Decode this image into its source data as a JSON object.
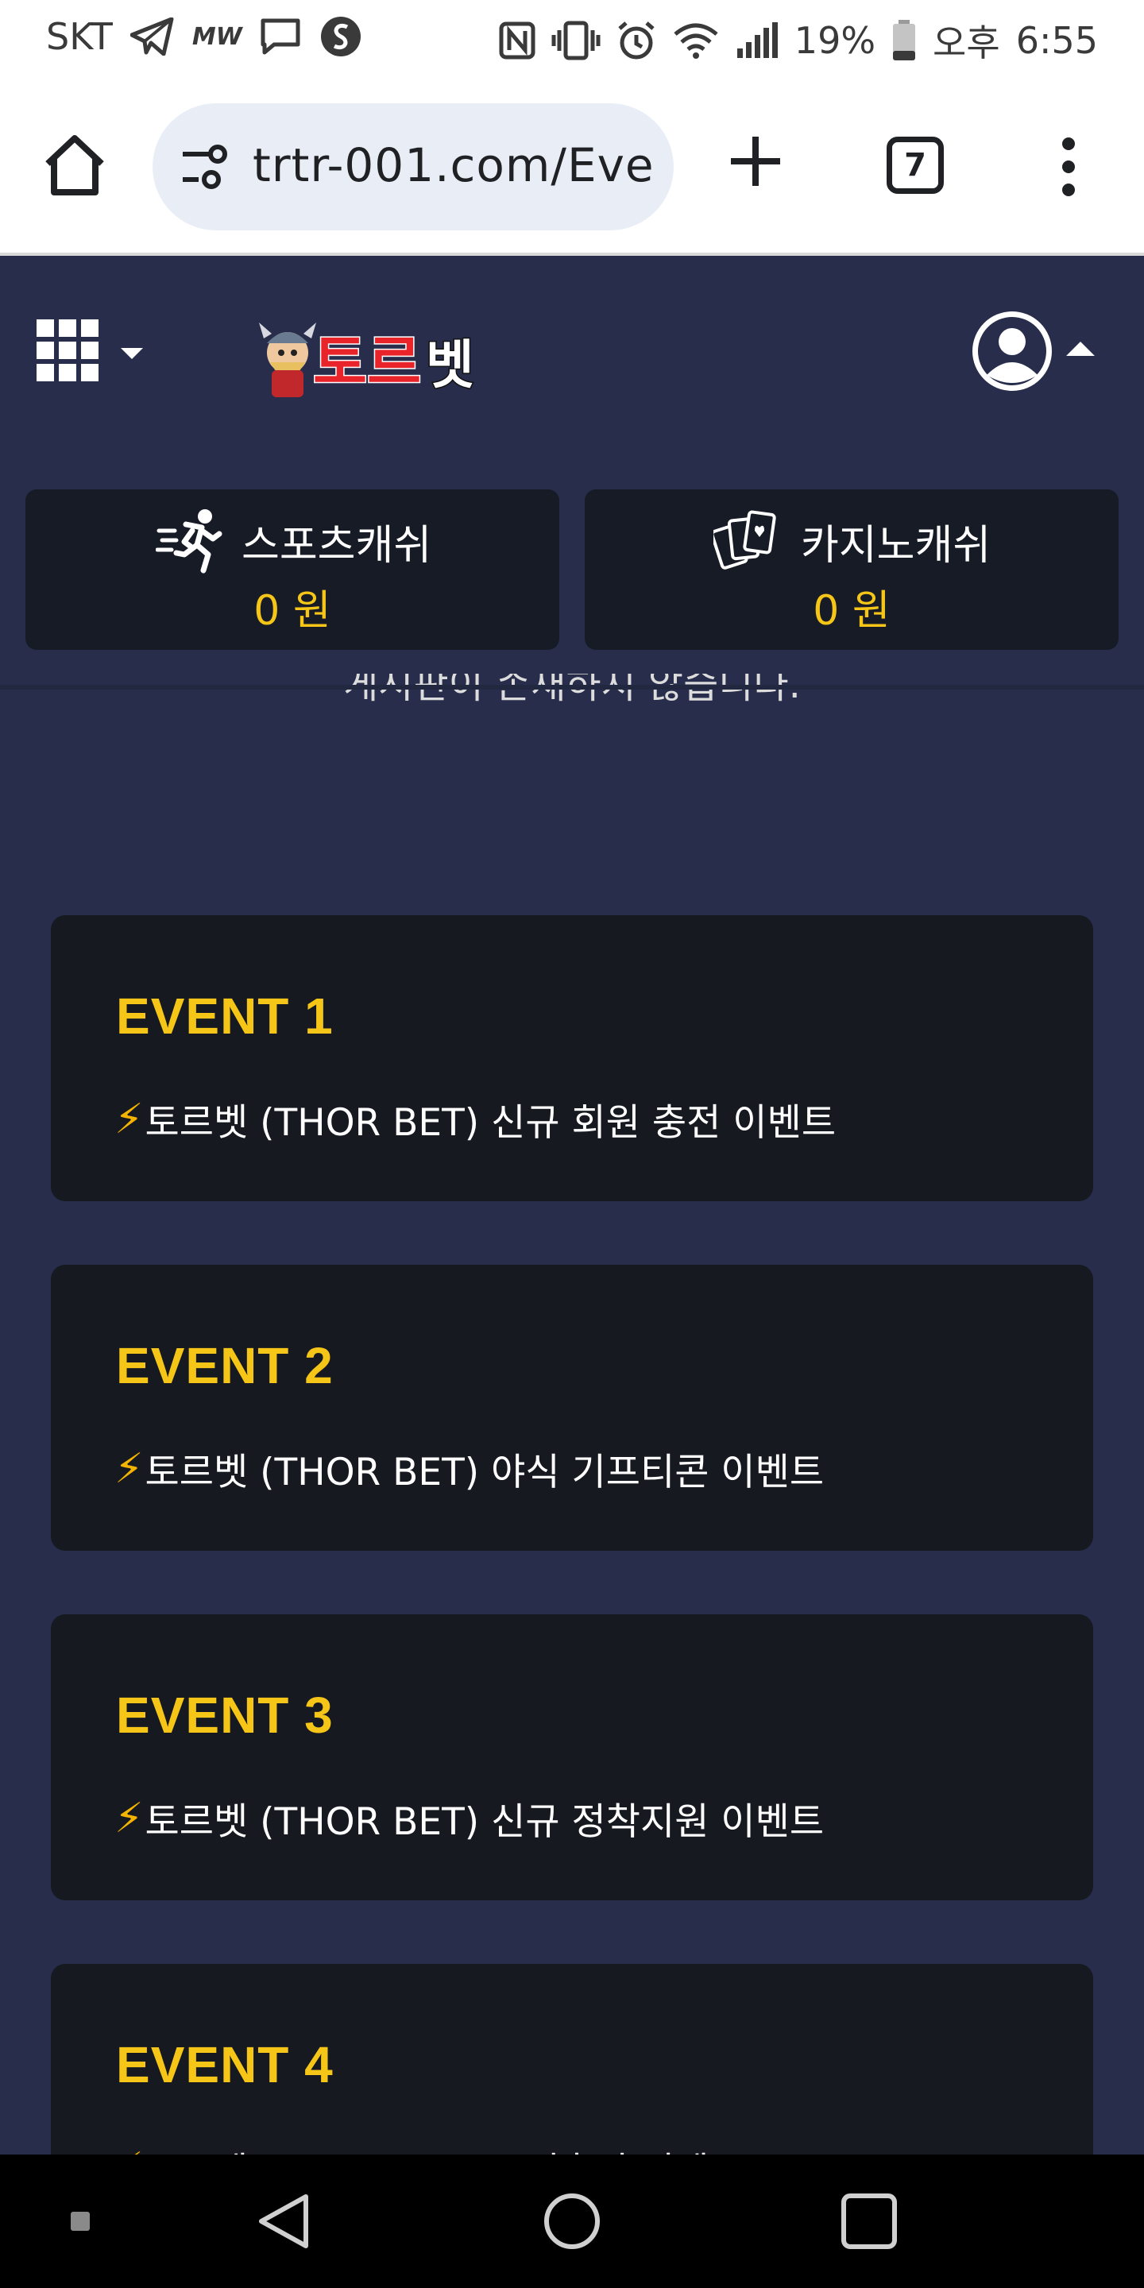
{
  "status_bar": {
    "carrier": "SKT",
    "mw_label": "MW",
    "battery": "19%",
    "ampm": "오후",
    "time": "6:55",
    "icons": [
      "telegram-icon",
      "mw-icon",
      "message-icon",
      "s-icon",
      "nfc-icon",
      "vibrate-icon",
      "alarm-icon",
      "wifi-icon",
      "signal-icon",
      "battery-icon"
    ]
  },
  "browser": {
    "url": "trtr-001.com/Eve",
    "tab_count": "7",
    "icons": [
      "home-icon",
      "site-settings-icon",
      "new-tab-icon",
      "tabs-icon",
      "more-vert-icon"
    ]
  },
  "header": {
    "logo_text": "토르벳",
    "icons": [
      "grid-menu-icon",
      "caret-down-icon",
      "user-icon",
      "caret-up-icon"
    ]
  },
  "cash": {
    "sports_label": "스포츠캐쉬",
    "sports_value": "0 원",
    "casino_label": "카지노캐쉬",
    "casino_value": "0 원"
  },
  "content": {
    "cut_text": "게시판이 존재하지 않습니다.",
    "events": [
      {
        "title": "EVENT 1",
        "bolt": "⚡",
        "desc": "토르벳 (THOR BET) 신규 회원 충전 이벤트"
      },
      {
        "title": "EVENT 2",
        "bolt": "⚡",
        "desc": "토르벳 (THOR BET) 야식 기프티콘 이벤트"
      },
      {
        "title": "EVENT 3",
        "bolt": "⚡",
        "desc": "토르벳 (THOR BET) 신규 정착지원 이벤트"
      },
      {
        "title": "EVENT 4",
        "bolt": "⚡",
        "desc": "토르벳 (THOR BET) 누적충전 이벤트"
      }
    ]
  },
  "colors": {
    "background": "#272d4b",
    "card": "#171921",
    "accent": "#f5c518",
    "nav": "#000000"
  }
}
